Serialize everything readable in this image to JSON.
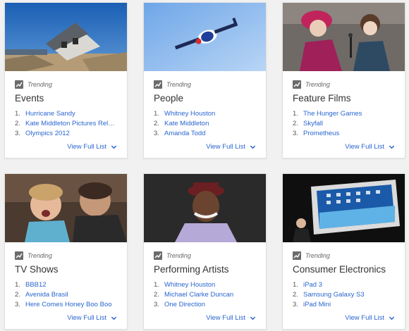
{
  "trending_label": "Trending",
  "view_full_list_label": "View Full List",
  "accent_color": "#2a66d0",
  "cards": [
    {
      "category": "Events",
      "image": "house-destroyed-hurricane",
      "items": [
        "Hurricane Sandy",
        "Kate Middleton Pictures Rele...",
        "Olympics 2012"
      ]
    },
    {
      "category": "People",
      "image": "skydiver-freefall",
      "items": [
        "Whitney Houston",
        "Kate Middleton",
        "Amanda Todd"
      ]
    },
    {
      "category": "Feature Films",
      "image": "film-characters",
      "items": [
        "The Hunger Games",
        "Skyfall",
        "Prometheus"
      ]
    },
    {
      "category": "TV Shows",
      "image": "tv-show-family",
      "items": [
        "BBB12",
        "Avenida Brasil",
        "Here Comes Honey Boo Boo"
      ]
    },
    {
      "category": "Performing Artists",
      "image": "actor-portrait",
      "items": [
        "Whitney Houston",
        "Michael Clarke Duncan",
        "One Direction"
      ]
    },
    {
      "category": "Consumer Electronics",
      "image": "tablet-launch",
      "items": [
        "iPad 3",
        "Samsung Galaxy S3",
        "iPad Mini"
      ]
    }
  ]
}
